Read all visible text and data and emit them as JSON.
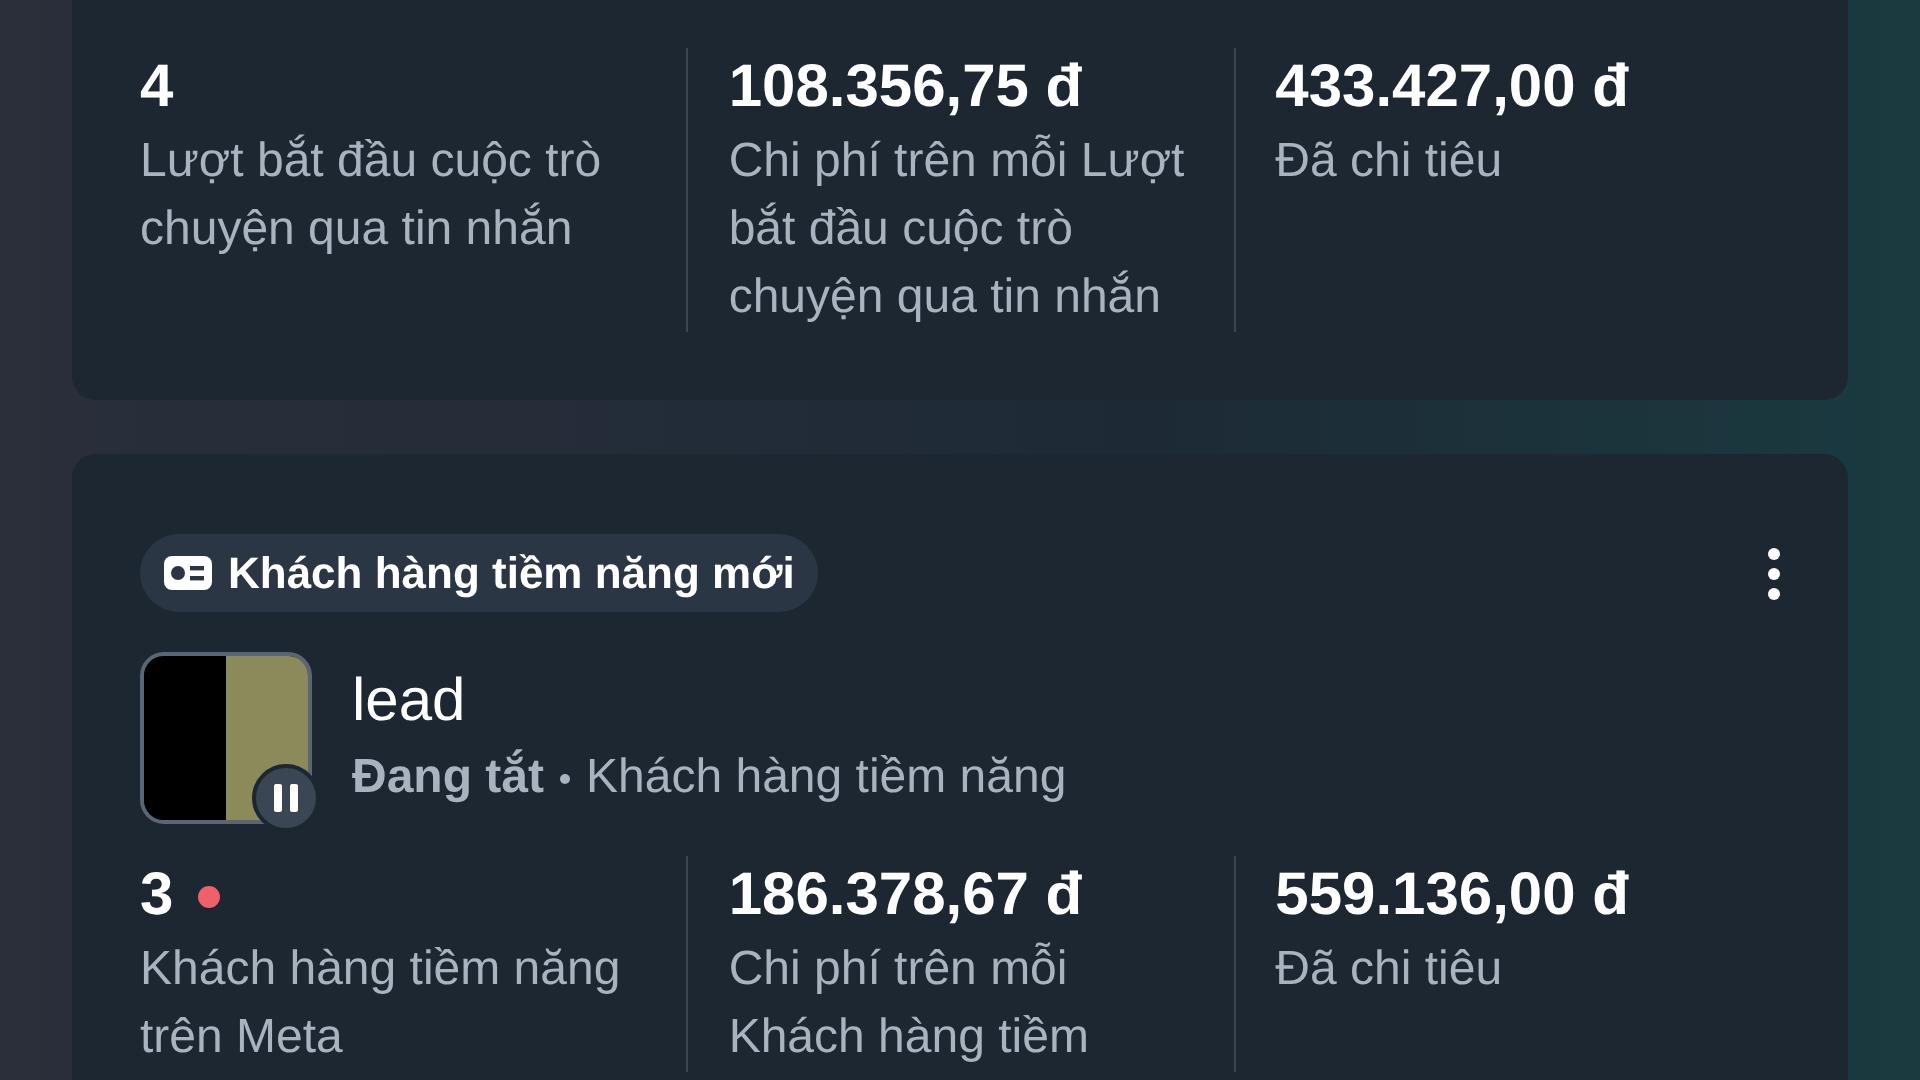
{
  "cards": [
    {
      "metrics": [
        {
          "value": "4",
          "label": "Lượt bắt đầu cuộc trò chuyện qua tin nhắn",
          "alert": false
        },
        {
          "value": "108.356,75 đ",
          "label": "Chi phí trên mỗi Lượt bắt đầu cuộc trò chuyện qua tin nhắn",
          "alert": false
        },
        {
          "value": "433.427,00 đ",
          "label": "Đã chi tiêu",
          "alert": false
        }
      ]
    },
    {
      "objective": "Khách hàng tiềm năng mới",
      "name": "lead",
      "status": "Đang tắt",
      "type": "Khách hàng tiềm năng",
      "metrics": [
        {
          "value": "3",
          "label": "Khách hàng tiềm năng trên Meta",
          "alert": true
        },
        {
          "value": "186.378,67 đ",
          "label": "Chi phí trên mỗi Khách hàng tiềm",
          "alert": false
        },
        {
          "value": "559.136,00 đ",
          "label": "Đã chi tiêu",
          "alert": false
        }
      ]
    }
  ]
}
